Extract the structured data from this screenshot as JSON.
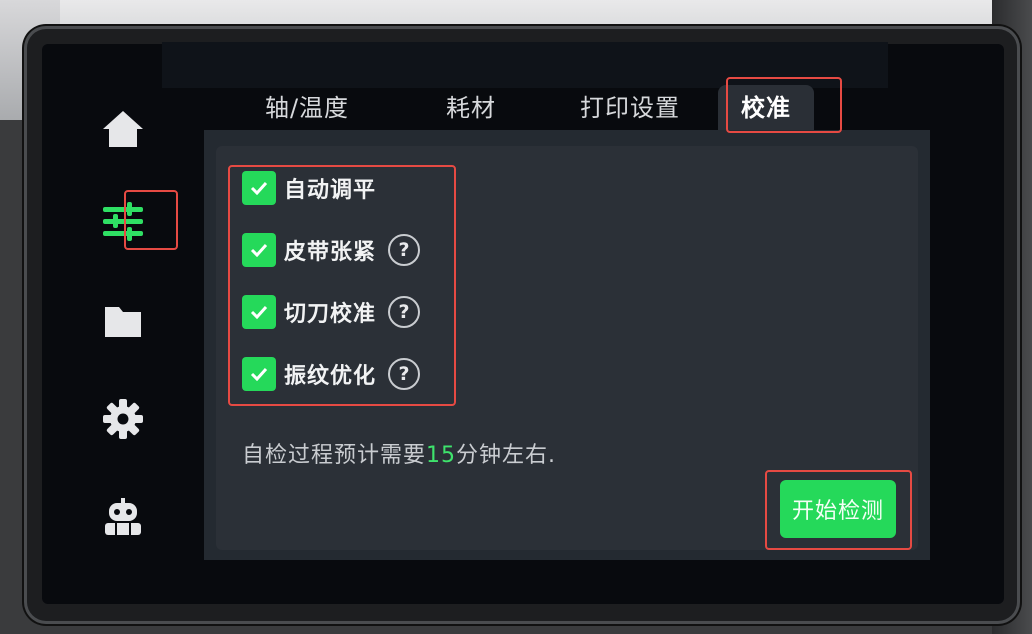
{
  "sidebar": {
    "items": [
      {
        "icon": "home-icon"
      },
      {
        "icon": "sliders-icon",
        "active": true
      },
      {
        "icon": "folder-icon"
      },
      {
        "icon": "gear-icon"
      },
      {
        "icon": "robot-icon"
      }
    ]
  },
  "tabs": {
    "axis_temp": "轴/温度",
    "filament": "耗材",
    "print_settings": "打印设置",
    "calibration": "校准"
  },
  "calibration": {
    "options": [
      {
        "label": "自动调平",
        "checked": true,
        "help": false
      },
      {
        "label": "皮带张紧",
        "checked": true,
        "help": true
      },
      {
        "label": "切刀校准",
        "checked": true,
        "help": true
      },
      {
        "label": "振纹优化",
        "checked": true,
        "help": true
      }
    ],
    "help_glyph": "?",
    "estimate_prefix": "自检过程预计需要",
    "estimate_minutes": "15",
    "estimate_suffix": "分钟左右.",
    "start_button": "开始检测"
  },
  "colors": {
    "accent": "#25d95a",
    "annotation": "#e64a43",
    "panel": "#2b3037",
    "screen": "#080a0e"
  }
}
